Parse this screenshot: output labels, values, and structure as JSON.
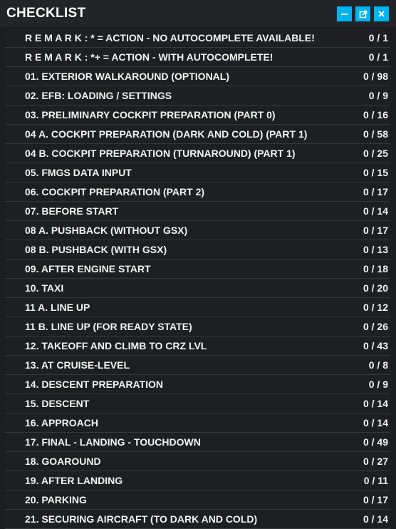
{
  "window": {
    "title": "CHECKLIST",
    "accent": "#00b4f0",
    "buttons": {
      "minimize_icon": "minimize-icon",
      "popout_icon": "popout-icon",
      "close_icon": "close-icon"
    }
  },
  "checklist": {
    "items": [
      {
        "label": "R E M A R K : * = ACTION - NO AUTOCOMPLETE AVAILABLE!",
        "count": "0 / 1"
      },
      {
        "label": "R E M A R K : *+ = ACTION - WITH AUTOCOMPLETE!",
        "count": "0 / 1"
      },
      {
        "label": "01. EXTERIOR WALKAROUND (OPTIONAL)",
        "count": "0 / 98"
      },
      {
        "label": "02. EFB: LOADING / SETTINGS",
        "count": "0 / 9"
      },
      {
        "label": "03. PRELIMINARY COCKPIT PREPARATION (PART 0)",
        "count": "0 / 16"
      },
      {
        "label": "04 A. COCKPIT PREPARATION (DARK AND COLD) (PART 1)",
        "count": "0 / 58"
      },
      {
        "label": "04 B. COCKPIT PREPARATION (TURNAROUND) (PART 1)",
        "count": "0 / 25"
      },
      {
        "label": "05. FMGS DATA INPUT",
        "count": "0 / 15"
      },
      {
        "label": "06. COCKPIT PREPARATION (PART 2)",
        "count": "0 / 17"
      },
      {
        "label": "07. BEFORE START",
        "count": "0 / 14"
      },
      {
        "label": "08 A. PUSHBACK (WITHOUT GSX)",
        "count": "0 / 17"
      },
      {
        "label": "08 B. PUSHBACK (WITH GSX)",
        "count": "0 / 13"
      },
      {
        "label": "09. AFTER ENGINE START",
        "count": "0 / 18"
      },
      {
        "label": "10. TAXI",
        "count": "0 / 20"
      },
      {
        "label": "11 A. LINE UP",
        "count": "0 / 12"
      },
      {
        "label": "11 B. LINE UP (FOR READY STATE)",
        "count": "0 / 26"
      },
      {
        "label": "12. TAKEOFF AND CLIMB TO CRZ LVL",
        "count": "0 / 43"
      },
      {
        "label": "13. AT CRUISE-LEVEL",
        "count": "0 / 8"
      },
      {
        "label": "14. DESCENT PREPARATION",
        "count": "0 / 9"
      },
      {
        "label": "15. DESCENT",
        "count": "0 / 14"
      },
      {
        "label": "16. APPROACH",
        "count": "0 / 14"
      },
      {
        "label": "17. FINAL - LANDING - TOUCHDOWN",
        "count": "0 / 49"
      },
      {
        "label": "18. GOAROUND",
        "count": "0 / 27"
      },
      {
        "label": "19. AFTER LANDING",
        "count": "0 / 11"
      },
      {
        "label": "20. PARKING",
        "count": "0 / 17"
      },
      {
        "label": "21. SECURING AIRCRAFT (TO DARK AND COLD)",
        "count": "0 / 14"
      }
    ]
  }
}
